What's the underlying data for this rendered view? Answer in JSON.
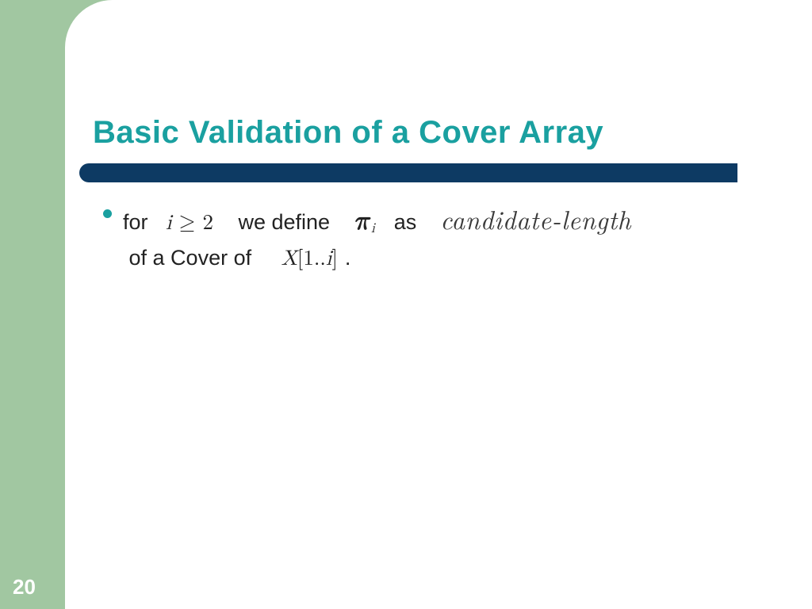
{
  "slide": {
    "number": "20",
    "title": "Basic Validation of a Cover Array",
    "bullet": {
      "t1": "for",
      "math_i_ge_2": "i ≥ 2",
      "t2": "we define",
      "math_pi_i_base": "π",
      "math_pi_i_sub": "i",
      "t3": "as",
      "candidate": "candidate-length",
      "t4": "of  a  Cover  of",
      "math_X_1i": "X[1..i]",
      "t5": "."
    }
  }
}
